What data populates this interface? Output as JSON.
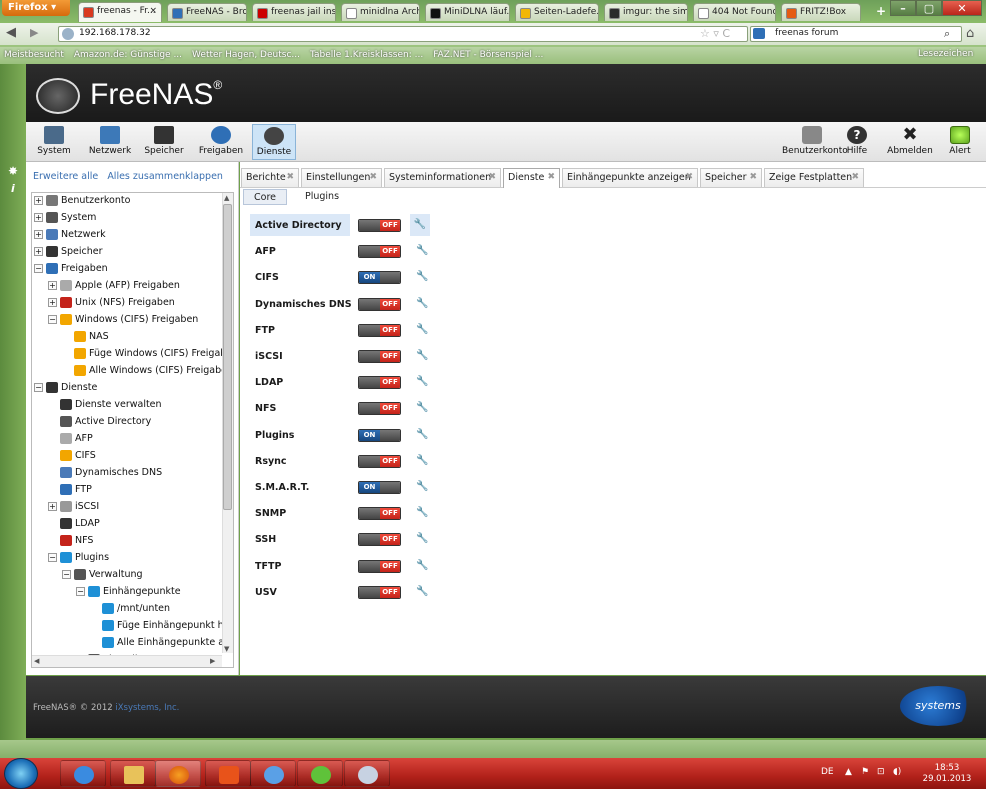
{
  "browser": {
    "menu_button": "Firefox",
    "tabs": [
      {
        "label": "freenas - Fr...",
        "active": true,
        "icon_color": "#d9391f"
      },
      {
        "label": "FreeNAS - Bro...",
        "active": false,
        "icon_color": "#2f6fb6"
      },
      {
        "label": "freenas jail inst...",
        "active": false,
        "icon_color": "#cc0000"
      },
      {
        "label": "minidlna Archi...",
        "active": false,
        "icon_color": "#ffffff"
      },
      {
        "label": "MiniDLNA läuf...",
        "active": false,
        "icon_color": "#111111"
      },
      {
        "label": "Seiten-Ladefe...",
        "active": false,
        "icon_color": "#f2b705"
      },
      {
        "label": "imgur: the sim...",
        "active": false,
        "icon_color": "#2b2b2b"
      },
      {
        "label": "404 Not Found",
        "active": false,
        "icon_color": "#ffffff"
      },
      {
        "label": "FRITZ!Box",
        "active": false,
        "icon_color": "#e55b13"
      }
    ],
    "new_tab": "+",
    "url": "192.168.178.32",
    "search_value": "freenas forum",
    "bookmarks": [
      "Meistbesucht",
      "Amazon.de: Günstige ...",
      "Wetter Hagen, Deutsc...",
      "Tabelle 1.Kreisklassen: ...",
      "FAZ.NET - Börsenspiel ..."
    ],
    "bookmarks_right": "Lesezeichen"
  },
  "app": {
    "logo": "FreeNAS",
    "logo_mark": "®",
    "toolbar_left": [
      {
        "label": "System",
        "icon": "system-icon"
      },
      {
        "label": "Netzwerk",
        "icon": "network-icon"
      },
      {
        "label": "Speicher",
        "icon": "storage-icon"
      },
      {
        "label": "Freigaben",
        "icon": "shares-icon"
      },
      {
        "label": "Dienste",
        "icon": "services-icon",
        "selected": true
      }
    ],
    "toolbar_right": [
      {
        "label": "Benutzerkonto",
        "icon": "account-icon"
      },
      {
        "label": "Hilfe",
        "icon": "help-icon"
      },
      {
        "label": "Abmelden",
        "icon": "logout-icon"
      },
      {
        "label": "Alert",
        "icon": "alert-icon"
      }
    ]
  },
  "tree": {
    "expand_all": "Erweitere alle",
    "collapse_all": "Alles zusammenklappen",
    "nodes": [
      {
        "label": "Benutzerkonto",
        "pm": "+",
        "color": "#777"
      },
      {
        "label": "System",
        "pm": "+",
        "color": "#555"
      },
      {
        "label": "Netzwerk",
        "pm": "+",
        "color": "#4a7ab8"
      },
      {
        "label": "Speicher",
        "pm": "+",
        "color": "#333"
      },
      {
        "label": "Freigaben",
        "pm": "−",
        "color": "#2f6fb6"
      },
      {
        "label": "Apple (AFP) Freigaben",
        "pm": "+",
        "color": "#aaa"
      },
      {
        "label": "Unix (NFS) Freigaben",
        "pm": "+",
        "color": "#c4231a"
      },
      {
        "label": "Windows (CIFS) Freigaben",
        "pm": "−",
        "color": "#f2a600"
      },
      {
        "label": "NAS",
        "pm": "",
        "color": "#f2a600"
      },
      {
        "label": "Füge Windows (CIFS) Freigab",
        "pm": "",
        "color": "#f2a600"
      },
      {
        "label": "Alle Windows (CIFS) Freigabe",
        "pm": "",
        "color": "#f2a600"
      },
      {
        "label": "Dienste",
        "pm": "−",
        "color": "#333"
      },
      {
        "label": "Dienste verwalten",
        "pm": "",
        "color": "#333"
      },
      {
        "label": "Active Directory",
        "pm": "",
        "color": "#555"
      },
      {
        "label": "AFP",
        "pm": "",
        "color": "#aaa"
      },
      {
        "label": "CIFS",
        "pm": "",
        "color": "#f2a600"
      },
      {
        "label": "Dynamisches DNS",
        "pm": "",
        "color": "#4a7ab8"
      },
      {
        "label": "FTP",
        "pm": "",
        "color": "#2f6fb6"
      },
      {
        "label": "iSCSI",
        "pm": "+",
        "color": "#999"
      },
      {
        "label": "LDAP",
        "pm": "",
        "color": "#333"
      },
      {
        "label": "NFS",
        "pm": "",
        "color": "#c4231a"
      },
      {
        "label": "Plugins",
        "pm": "−",
        "color": "#1e90d6"
      },
      {
        "label": "Verwaltung",
        "pm": "−",
        "color": "#555"
      },
      {
        "label": "Einhängepunkte",
        "pm": "−",
        "color": "#1e90d6"
      },
      {
        "label": "/mnt/unten",
        "pm": "",
        "color": "#1e90d6"
      },
      {
        "label": "Füge Einhängepunkt hi",
        "pm": "",
        "color": "#1e90d6"
      },
      {
        "label": "Alle Einhängepunkte ar",
        "pm": "",
        "color": "#1e90d6"
      },
      {
        "label": "Einstellungen",
        "pm": "",
        "color": "#555"
      }
    ]
  },
  "panel_tabs": [
    {
      "label": "Berichte",
      "active": false
    },
    {
      "label": "Einstellungen",
      "active": false
    },
    {
      "label": "Systeminformationen",
      "active": false
    },
    {
      "label": "Dienste",
      "active": true
    },
    {
      "label": "Einhängepunkte anzeigen",
      "active": false
    },
    {
      "label": "Speicher",
      "active": false
    },
    {
      "label": "Zeige Festplatten",
      "active": false
    }
  ],
  "close_glyph": "✖",
  "sub_tabs": [
    {
      "label": "Core",
      "active": true
    },
    {
      "label": "Plugins",
      "active": false
    }
  ],
  "services": [
    {
      "name": "Active Directory",
      "state": "OFF",
      "highlighted": true
    },
    {
      "name": "AFP",
      "state": "OFF"
    },
    {
      "name": "CIFS",
      "state": "ON"
    },
    {
      "name": "Dynamisches DNS",
      "state": "OFF"
    },
    {
      "name": "FTP",
      "state": "OFF"
    },
    {
      "name": "iSCSI",
      "state": "OFF"
    },
    {
      "name": "LDAP",
      "state": "OFF"
    },
    {
      "name": "NFS",
      "state": "OFF"
    },
    {
      "name": "Plugins",
      "state": "ON"
    },
    {
      "name": "Rsync",
      "state": "OFF"
    },
    {
      "name": "S.M.A.R.T.",
      "state": "ON"
    },
    {
      "name": "SNMP",
      "state": "OFF"
    },
    {
      "name": "SSH",
      "state": "OFF"
    },
    {
      "name": "TFTP",
      "state": "OFF"
    },
    {
      "name": "USV",
      "state": "OFF"
    }
  ],
  "footer": {
    "text": "FreeNAS® © 2012 ",
    "company": "iXsystems, Inc.",
    "logo": "systems"
  },
  "taskbar": {
    "lang": "DE",
    "time": "18:53",
    "date": "29.01.2013"
  }
}
